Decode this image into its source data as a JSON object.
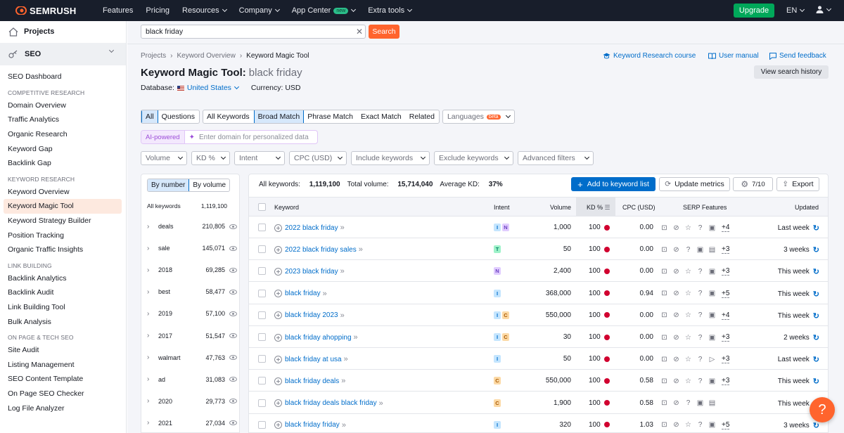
{
  "topbar": {
    "logo": "SEMRUSH",
    "nav": [
      {
        "label": "Features",
        "dropdown": false
      },
      {
        "label": "Pricing",
        "dropdown": false
      },
      {
        "label": "Resources",
        "dropdown": true
      },
      {
        "label": "Company",
        "dropdown": true
      },
      {
        "label": "App Center",
        "dropdown": true,
        "badge": "new"
      },
      {
        "label": "Extra tools",
        "dropdown": true
      }
    ],
    "upgrade": "Upgrade",
    "lang": "EN",
    "brand_color": "#ff642d"
  },
  "sidebar": {
    "projects": "Projects",
    "seo": "SEO",
    "dashboard": "SEO Dashboard",
    "sections": [
      {
        "title": "COMPETITIVE RESEARCH",
        "items": [
          "Domain Overview",
          "Traffic Analytics",
          "Organic Research",
          "Keyword Gap",
          "Backlink Gap"
        ]
      },
      {
        "title": "KEYWORD RESEARCH",
        "items": [
          "Keyword Overview",
          "Keyword Magic Tool",
          "Keyword Strategy Builder",
          "Position Tracking",
          "Organic Traffic Insights"
        ]
      },
      {
        "title": "LINK BUILDING",
        "items": [
          "Backlink Analytics",
          "Backlink Audit",
          "Link Building Tool",
          "Bulk Analysis"
        ]
      },
      {
        "title": "ON PAGE & TECH SEO",
        "items": [
          "Site Audit",
          "Listing Management",
          "SEO Content Template",
          "On Page SEO Checker",
          "Log File Analyzer"
        ]
      }
    ]
  },
  "search": {
    "value": "black friday",
    "button": "Search"
  },
  "breadcrumb": [
    "Projects",
    "Keyword Overview",
    "Keyword Magic Tool"
  ],
  "links": {
    "course": "Keyword Research course",
    "manual": "User manual",
    "feedback": "Send feedback"
  },
  "page": {
    "title": "Keyword Magic Tool:",
    "query": "black friday",
    "view_history": "View search history",
    "database_label": "Database:",
    "database": "United States",
    "currency": "Currency: USD"
  },
  "match_filters": {
    "group1": [
      "All",
      "Questions"
    ],
    "group2": [
      "All Keywords",
      "Broad Match",
      "Phrase Match",
      "Exact Match",
      "Related"
    ],
    "languages": "Languages",
    "beta": "beta"
  },
  "ai": {
    "tag": "AI-powered",
    "placeholder": "Enter domain for personalized data"
  },
  "filters": [
    "Volume",
    "KD %",
    "Intent",
    "CPC (USD)",
    "Include keywords",
    "Exclude keywords",
    "Advanced filters"
  ],
  "groups": {
    "by_number": "By number",
    "by_volume": "By volume",
    "header_label": "All keywords",
    "header_count": "1,119,100",
    "rows": [
      {
        "name": "deals",
        "count": "210,805"
      },
      {
        "name": "sale",
        "count": "145,071"
      },
      {
        "name": "2018",
        "count": "69,285"
      },
      {
        "name": "best",
        "count": "58,477"
      },
      {
        "name": "2019",
        "count": "57,100"
      },
      {
        "name": "2017",
        "count": "51,547"
      },
      {
        "name": "walmart",
        "count": "47,763"
      },
      {
        "name": "ad",
        "count": "31,083"
      },
      {
        "name": "2020",
        "count": "29,773"
      },
      {
        "name": "2021",
        "count": "27,034"
      }
    ]
  },
  "summary": {
    "all_keywords_label": "All keywords:",
    "all_keywords": "1,119,100",
    "total_volume_label": "Total volume:",
    "total_volume": "15,714,040",
    "avg_kd_label": "Average KD:",
    "avg_kd": "37%"
  },
  "actions": {
    "add": "Add to keyword list",
    "update": "Update metrics",
    "settings": "7/10",
    "export": "Export"
  },
  "table": {
    "headers": {
      "keyword": "Keyword",
      "intent": "Intent",
      "volume": "Volume",
      "kd": "KD %",
      "cpc": "CPC (USD)",
      "serp": "SERP Features",
      "updated": "Updated"
    },
    "rows": [
      {
        "keyword": "2022 black friday",
        "intent": [
          "I",
          "N"
        ],
        "volume": "1,000",
        "kd": "100",
        "cpc": "0.00",
        "serp": [
          "img",
          "link",
          "star",
          "q",
          "img2"
        ],
        "more": "+4",
        "updated": "Last week"
      },
      {
        "keyword": "2022 black friday sales",
        "intent": [
          "T"
        ],
        "volume": "50",
        "kd": "100",
        "cpc": "0.00",
        "serp": [
          "img",
          "link",
          "q",
          "img2",
          "img3"
        ],
        "more": "+3",
        "updated": "3 weeks"
      },
      {
        "keyword": "2023 black friday",
        "intent": [
          "N"
        ],
        "volume": "2,400",
        "kd": "100",
        "cpc": "0.00",
        "serp": [
          "img",
          "link",
          "star",
          "q",
          "img2"
        ],
        "more": "+3",
        "updated": "This week"
      },
      {
        "keyword": "black friday",
        "intent": [
          "I"
        ],
        "volume": "368,000",
        "kd": "100",
        "cpc": "0.94",
        "serp": [
          "img",
          "link",
          "star",
          "q",
          "img2"
        ],
        "more": "+5",
        "updated": "This week"
      },
      {
        "keyword": "black friday 2023",
        "intent": [
          "I",
          "C"
        ],
        "volume": "550,000",
        "kd": "100",
        "cpc": "0.00",
        "serp": [
          "img",
          "link",
          "star",
          "q",
          "img2"
        ],
        "more": "+4",
        "updated": "This week"
      },
      {
        "keyword": "black friday ahopping",
        "intent": [
          "I",
          "C"
        ],
        "volume": "30",
        "kd": "100",
        "cpc": "0.00",
        "serp": [
          "img",
          "link",
          "star",
          "q",
          "img2"
        ],
        "more": "+3",
        "updated": "2 weeks"
      },
      {
        "keyword": "black friday at usa",
        "intent": [
          "I"
        ],
        "volume": "50",
        "kd": "100",
        "cpc": "0.00",
        "serp": [
          "img",
          "link",
          "star",
          "q",
          "play"
        ],
        "more": "+3",
        "updated": "Last week"
      },
      {
        "keyword": "black friday deals",
        "intent": [
          "C"
        ],
        "volume": "550,000",
        "kd": "100",
        "cpc": "0.58",
        "serp": [
          "img",
          "link",
          "star",
          "q",
          "img2"
        ],
        "more": "+3",
        "updated": "This week"
      },
      {
        "keyword": "black friday deals black friday",
        "intent": [
          "C"
        ],
        "volume": "1,900",
        "kd": "100",
        "cpc": "0.58",
        "serp": [
          "img",
          "link",
          "q",
          "img2",
          "img3"
        ],
        "more": "",
        "updated": "This week"
      },
      {
        "keyword": "black friday friday",
        "intent": [
          "I"
        ],
        "volume": "320",
        "kd": "100",
        "cpc": "1.03",
        "serp": [
          "img",
          "link",
          "star",
          "q",
          "img2"
        ],
        "more": "+5",
        "updated": "3 weeks"
      }
    ]
  }
}
